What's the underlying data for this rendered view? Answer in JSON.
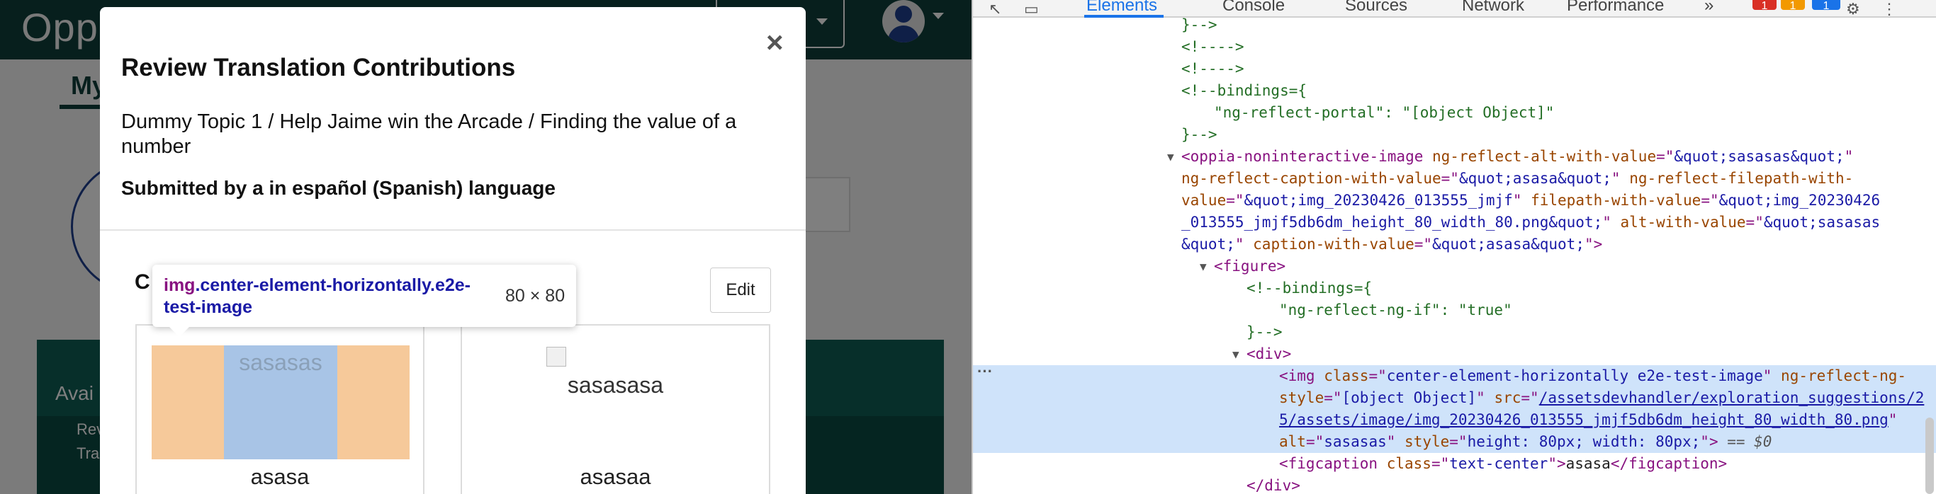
{
  "app": {
    "logo_text": "Oppia",
    "bg_tab_label": "My",
    "bg_panel_title": "Avai",
    "bg_panel_sub1": "Rev",
    "bg_panel_sub2": "Tra"
  },
  "modal": {
    "title": "Review Translation Contributions",
    "breadcrumb": "Dummy Topic 1 / Help Jaime win the Arcade / Finding the value of a number",
    "submitted_by": "Submitted by a in español (Spanish) language",
    "section_label_visible": "C",
    "section_label_colon": ":",
    "edit_label": "Edit",
    "close_symbol": "×",
    "left_image_alt": "sasasas",
    "left_caption": "asasa",
    "right_image_alt": "sasasasa",
    "right_caption": "asasaa"
  },
  "tooltip": {
    "tag_name": "img",
    "class_text": ".center-element-horizontally.e2e-test-image",
    "dims": "80 × 80"
  },
  "devtools": {
    "tabs": [
      "Elements",
      "Console",
      "Sources",
      "Network",
      "Performance"
    ],
    "more_tabs": "»",
    "errors": "1",
    "warnings": "1",
    "messages": "1",
    "ellipsis": "···",
    "lines": [
      {
        "indent": 0,
        "parts": [
          {
            "t": "}-->",
            "c": "c-comment"
          }
        ]
      },
      {
        "indent": 0,
        "parts": [
          {
            "t": "<!---->",
            "c": "c-comment"
          }
        ]
      },
      {
        "indent": 0,
        "parts": [
          {
            "t": "<!---->",
            "c": "c-comment"
          }
        ]
      },
      {
        "indent": 0,
        "parts": [
          {
            "t": "<!--bindings={",
            "c": "c-comment"
          }
        ]
      },
      {
        "indent": 1,
        "parts": [
          {
            "t": "\"ng-reflect-portal\": \"[object Object]\"",
            "c": "c-comment"
          }
        ]
      },
      {
        "indent": 0,
        "parts": [
          {
            "t": "}-->",
            "c": "c-comment"
          }
        ]
      },
      {
        "indent": 0,
        "tri": "▼",
        "parts": [
          {
            "t": "<oppia-noninteractive-image ",
            "c": "c-tag"
          },
          {
            "t": "ng-reflect-alt-with-value",
            "c": "c-attr"
          },
          {
            "t": "=\"",
            "c": "c-tag"
          },
          {
            "t": "&quot;sasasas&quot;",
            "c": "c-val"
          },
          {
            "t": "\"",
            "c": "c-tag"
          }
        ]
      },
      {
        "indent": 0,
        "parts": [
          {
            "t": "ng-reflect-caption-with-value",
            "c": "c-attr"
          },
          {
            "t": "=\"",
            "c": "c-tag"
          },
          {
            "t": "&quot;asasa&quot;",
            "c": "c-val"
          },
          {
            "t": "\" ",
            "c": "c-tag"
          },
          {
            "t": "ng-reflect-filepath-with-",
            "c": "c-attr"
          }
        ]
      },
      {
        "indent": 0,
        "parts": [
          {
            "t": "value",
            "c": "c-attr"
          },
          {
            "t": "=\"",
            "c": "c-tag"
          },
          {
            "t": "&quot;img_20230426_013555_jmjf",
            "c": "c-val"
          },
          {
            "t": "\" ",
            "c": "c-tag"
          },
          {
            "t": "filepath-with-value",
            "c": "c-attr"
          },
          {
            "t": "=\"",
            "c": "c-tag"
          },
          {
            "t": "&quot;img_20230426",
            "c": "c-val"
          }
        ]
      },
      {
        "indent": 0,
        "parts": [
          {
            "t": "_013555_jmjf5db6dm_height_80_width_80.png&quot;",
            "c": "c-val"
          },
          {
            "t": "\" ",
            "c": "c-tag"
          },
          {
            "t": "alt-with-value",
            "c": "c-attr"
          },
          {
            "t": "=\"",
            "c": "c-tag"
          },
          {
            "t": "&quot;sasasas",
            "c": "c-val"
          }
        ]
      },
      {
        "indent": 0,
        "parts": [
          {
            "t": "&quot;",
            "c": "c-val"
          },
          {
            "t": "\" ",
            "c": "c-tag"
          },
          {
            "t": "caption-with-value",
            "c": "c-attr"
          },
          {
            "t": "=\"",
            "c": "c-tag"
          },
          {
            "t": "&quot;asasa&quot;",
            "c": "c-val"
          },
          {
            "t": "\">",
            "c": "c-tag"
          }
        ]
      },
      {
        "indent": 1,
        "tri": "▼",
        "parts": [
          {
            "t": "<figure>",
            "c": "c-tag"
          }
        ]
      },
      {
        "indent": 2,
        "parts": [
          {
            "t": "<!--bindings={",
            "c": "c-comment"
          }
        ]
      },
      {
        "indent": 3,
        "parts": [
          {
            "t": "\"ng-reflect-ng-if\": \"true\"",
            "c": "c-comment"
          }
        ]
      },
      {
        "indent": 2,
        "parts": [
          {
            "t": "}-->",
            "c": "c-comment"
          }
        ]
      },
      {
        "indent": 2,
        "tri": "▼",
        "parts": [
          {
            "t": "<div>",
            "c": "c-tag"
          }
        ]
      },
      {
        "indent": 3,
        "selected": true,
        "parts": [
          {
            "t": "<img ",
            "c": "c-tag"
          },
          {
            "t": "class",
            "c": "c-attr"
          },
          {
            "t": "=\"",
            "c": "c-tag"
          },
          {
            "t": "center-element-horizontally e2e-test-image",
            "c": "c-val"
          },
          {
            "t": "\" ",
            "c": "c-tag"
          },
          {
            "t": "ng-reflect-ng-",
            "c": "c-attr"
          }
        ]
      },
      {
        "indent": 3,
        "selected": true,
        "parts": [
          {
            "t": "style",
            "c": "c-attr"
          },
          {
            "t": "=\"",
            "c": "c-tag"
          },
          {
            "t": "[object Object]",
            "c": "c-val"
          },
          {
            "t": "\" ",
            "c": "c-tag"
          },
          {
            "t": "src",
            "c": "c-attr"
          },
          {
            "t": "=\"",
            "c": "c-tag"
          },
          {
            "t": "/assetsdevhandler/exploration_suggestions/2",
            "c": "c-link"
          }
        ]
      },
      {
        "indent": 3,
        "selected": true,
        "parts": [
          {
            "t": "5/assets/image/img_20230426_013555_jmjf5db6dm_height_80_width_80.png",
            "c": "c-link"
          },
          {
            "t": "\"",
            "c": "c-tag"
          }
        ]
      },
      {
        "indent": 3,
        "selected": true,
        "parts": [
          {
            "t": "alt",
            "c": "c-attr"
          },
          {
            "t": "=\"",
            "c": "c-tag"
          },
          {
            "t": "sasasas",
            "c": "c-val"
          },
          {
            "t": "\" ",
            "c": "c-tag"
          },
          {
            "t": "style",
            "c": "c-attr"
          },
          {
            "t": "=\"",
            "c": "c-tag"
          },
          {
            "t": "height: 80px; width: 80px;",
            "c": "c-val"
          },
          {
            "t": "\">",
            "c": "c-tag"
          },
          {
            "t": " == $0",
            "c": "c-eq"
          }
        ]
      },
      {
        "indent": 3,
        "parts": [
          {
            "t": "<figcaption ",
            "c": "c-tag"
          },
          {
            "t": "class",
            "c": "c-attr"
          },
          {
            "t": "=\"",
            "c": "c-tag"
          },
          {
            "t": "text-center",
            "c": "c-val"
          },
          {
            "t": "\">",
            "c": "c-tag"
          },
          {
            "t": "asasa",
            "c": ""
          },
          {
            "t": "</figcaption>",
            "c": "c-tag"
          }
        ]
      },
      {
        "indent": 2,
        "parts": [
          {
            "t": "</div>",
            "c": "c-tag"
          }
        ]
      }
    ]
  },
  "colors": {
    "topbar": "#0e3f3a",
    "devtools_active": "#1a73e8",
    "selected_row": "#cfe3fa",
    "image_margin": "#f6c99a",
    "image_box": "#a8c4e6"
  }
}
